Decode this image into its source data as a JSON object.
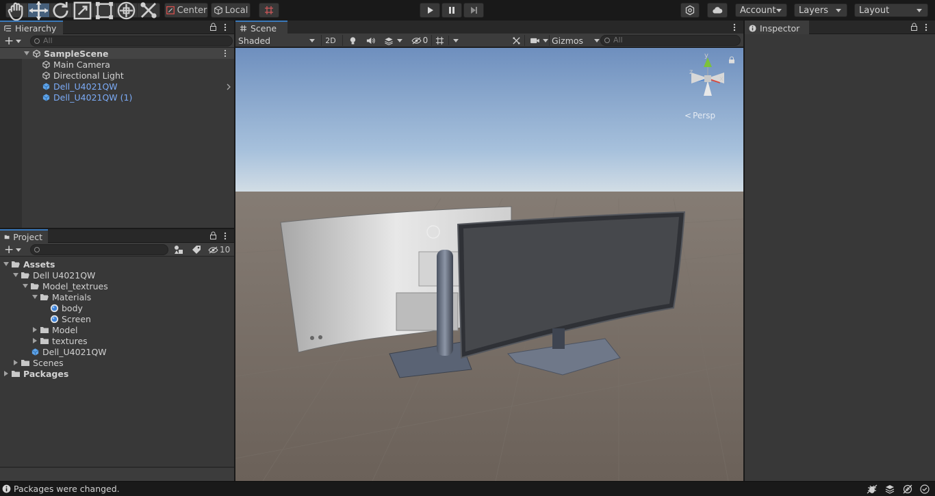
{
  "toolbar": {
    "tools": [
      "hand-tool",
      "move-tool",
      "rotate-tool",
      "scale-tool",
      "rect-tool",
      "transform-tool",
      "custom-tool"
    ],
    "pivot_mode": "Center",
    "pivot_rotation": "Local",
    "play_controls": [
      "play",
      "pause",
      "step"
    ],
    "account": "Account",
    "layers": "Layers",
    "layout": "Layout"
  },
  "hierarchy": {
    "tab": "Hierarchy",
    "search_placeholder": "All",
    "scene": "SampleScene",
    "items": [
      {
        "label": "Main Camera",
        "type": "gameobject"
      },
      {
        "label": "Directional Light",
        "type": "gameobject"
      },
      {
        "label": "Dell_U4021QW",
        "type": "prefab"
      },
      {
        "label": "Dell_U4021QW (1)",
        "type": "prefab"
      }
    ]
  },
  "project": {
    "tab": "Project",
    "hidden_count": "10",
    "tree": [
      {
        "label": "Assets",
        "kind": "folder",
        "bold": true
      },
      {
        "label": "Dell U4021QW",
        "kind": "folder"
      },
      {
        "label": "Model_textrues",
        "kind": "folder"
      },
      {
        "label": "Materials",
        "kind": "folder"
      },
      {
        "label": "body",
        "kind": "material"
      },
      {
        "label": "Screen",
        "kind": "material"
      },
      {
        "label": "Model",
        "kind": "folder"
      },
      {
        "label": "textures",
        "kind": "folder"
      },
      {
        "label": "Dell_U4021QW",
        "kind": "prefab"
      },
      {
        "label": "Scenes",
        "kind": "folder"
      },
      {
        "label": "Packages",
        "kind": "folder",
        "bold": true
      }
    ]
  },
  "scene": {
    "tab": "Scene",
    "shading": "Shaded",
    "mode_2d": "2D",
    "hidden_count": "0",
    "gizmos": "Gizmos",
    "search_placeholder": "All",
    "projection": "Persp",
    "axes": [
      "y",
      "x",
      "z"
    ]
  },
  "inspector": {
    "tab": "Inspector"
  },
  "status": {
    "message": "Packages were changed."
  },
  "colors": {
    "accent": "#3a79bb",
    "prefab_text": "#7cacf8",
    "panel": "#383838",
    "sky_top": "#6d8ebd",
    "ground": "#6c645d"
  }
}
